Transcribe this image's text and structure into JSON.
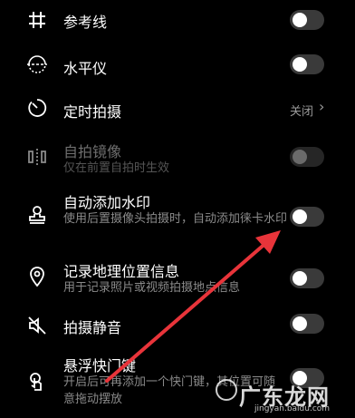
{
  "settings": {
    "grid": {
      "label": "参考线",
      "icon": "grid-icon",
      "enabled": false
    },
    "level": {
      "label": "水平仪",
      "icon": "level-icon",
      "enabled": false
    },
    "timer": {
      "label": "定时拍摄",
      "icon": "timer-icon",
      "value": "关闭",
      "chevron": "›"
    },
    "mirror": {
      "label": "自拍镜像",
      "sub": "仅在前置自拍时生效",
      "icon": "mirror-icon",
      "enabled": false,
      "disabled": true
    },
    "watermark": {
      "label": "自动添加水印",
      "sub": "使用后置摄像头拍摄时，自动添加徕卡水印",
      "icon": "stamp-icon",
      "enabled": false
    },
    "location": {
      "label": "记录地理位置信息",
      "sub": "用于记录照片或视频拍摄地点信息",
      "icon": "location-pin-icon",
      "enabled": false
    },
    "mute": {
      "label": "拍摄静音",
      "icon": "mute-icon",
      "enabled": false
    },
    "floating": {
      "label": "悬浮快门键",
      "sub": "开启后可再添加一个快门键，其位置可随意拖动摆放",
      "icon": "touch-icon",
      "enabled": false
    }
  },
  "annotation_color": "#e8343a",
  "watermark_overlay": {
    "text": "广东龙网",
    "url": "jingyan.baidu.com"
  }
}
